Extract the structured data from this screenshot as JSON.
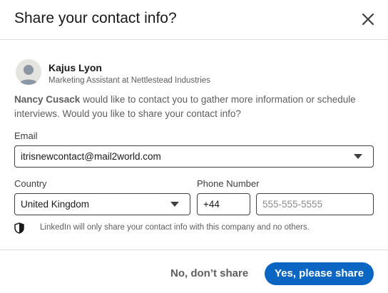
{
  "dialog": {
    "title": "Share your contact info?",
    "close_icon": "close-icon"
  },
  "profile": {
    "name": "Kajus Lyon",
    "title": "Marketing Assistant at Nettlestead Industries",
    "avatar_icon": "person-avatar-icon"
  },
  "message": {
    "requester": "Nancy Cusack",
    "text": " would like to contact you to gather more information or schedule interviews. Would you like to share your contact info?"
  },
  "form": {
    "email_label": "Email",
    "email_value": "itrisnewcontact@mail2world.com",
    "country_label": "Country",
    "country_value": "United Kingdom",
    "phone_label": "Phone Number",
    "phone_code": "+44",
    "phone_placeholder": "555-555-5555"
  },
  "notice": {
    "icon": "shield-icon",
    "text": "LinkedIn will only share your contact info with this company and no others."
  },
  "footer": {
    "decline_label": "No, don’t share",
    "accept_label": "Yes, please share"
  },
  "colors": {
    "primary": "#0a66c2",
    "text": "#191919",
    "muted": "#5e5e5e",
    "border": "#404040",
    "divider": "#e0dfdc"
  }
}
